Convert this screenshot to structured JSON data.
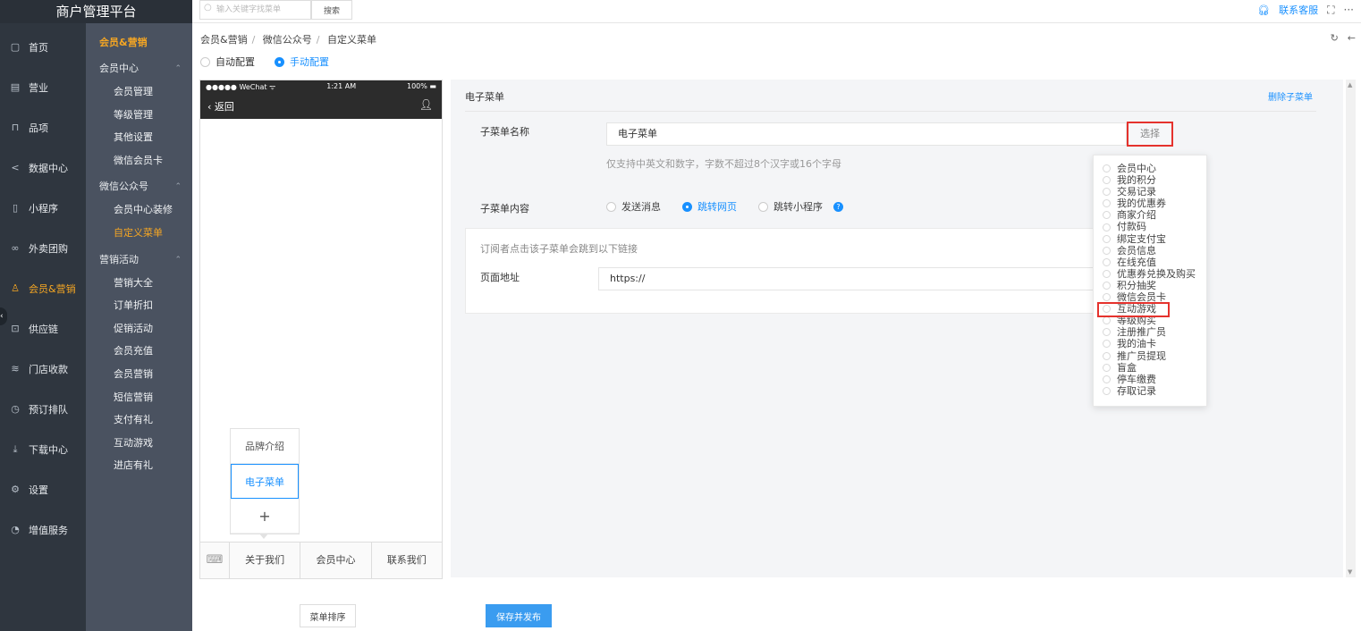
{
  "brand": "商户管理平台",
  "search": {
    "placeholder": "输入关键字找菜单",
    "button": "搜索"
  },
  "top_right": {
    "service": "联系客服",
    "fullscreen_icon": "⛶",
    "more_icon": "···"
  },
  "nav": [
    {
      "label": "首页",
      "icon": "▢"
    },
    {
      "label": "营业",
      "icon": "▤"
    },
    {
      "label": "品项",
      "icon": "⊓"
    },
    {
      "label": "数据中心",
      "icon": "<"
    },
    {
      "label": "小程序",
      "icon": "▯"
    },
    {
      "label": "外卖团购",
      "icon": "∞"
    },
    {
      "label": "会员&营销",
      "icon": "♙",
      "active": true
    },
    {
      "label": "供应链",
      "icon": "⊡"
    },
    {
      "label": "门店收款",
      "icon": "≋"
    },
    {
      "label": "预订排队",
      "icon": "◷"
    },
    {
      "label": "下载中心",
      "icon": "⤓"
    },
    {
      "label": "设置",
      "icon": "⚙"
    },
    {
      "label": "增值服务",
      "icon": "◔"
    }
  ],
  "subnav": {
    "title": "会员&营销",
    "groups": [
      {
        "name": "会员中心",
        "items": [
          "会员管理",
          "等级管理",
          "其他设置",
          "微信会员卡"
        ]
      },
      {
        "name": "微信公众号",
        "items": [
          "会员中心装修",
          "自定义菜单"
        ]
      },
      {
        "name": "营销活动",
        "items": [
          "营销大全",
          "订单折扣",
          "促销活动",
          "会员充值",
          "会员营销",
          "短信营销",
          "支付有礼",
          "互动游戏",
          "进店有礼"
        ]
      }
    ]
  },
  "breadcrumb": [
    "会员&营销",
    "微信公众号",
    "自定义菜单"
  ],
  "config": {
    "auto": "自动配置",
    "manual": "手动配置"
  },
  "phone": {
    "carrier": "●●●●● WeChat ᯤ",
    "time": "1:21 AM",
    "battery": "100% ▬",
    "back": "返回",
    "popup": [
      "品牌介绍",
      "电子菜单",
      "+"
    ],
    "footer": [
      "关于我们",
      "会员中心",
      "联系我们"
    ]
  },
  "editor": {
    "title": "电子菜单",
    "delete": "删除子菜单",
    "name_label": "子菜单名称",
    "name_value": "电子菜单",
    "choose": "选择",
    "hint": "仅支持中英文和数字，字数不超过8个汉字或16个字母",
    "content_label": "子菜单内容",
    "content_options": [
      "发送消息",
      "跳转网页",
      "跳转小程序"
    ],
    "link_hint": "订阅者点击该子菜单会跳到以下链接",
    "url_label": "页面地址",
    "url_value": "https://"
  },
  "dropdown": [
    "会员中心",
    "我的积分",
    "交易记录",
    "我的优惠券",
    "商家介绍",
    "付款码",
    "绑定支付宝",
    "会员信息",
    "在线充值",
    "优惠券兑换及购买",
    "积分抽奖",
    "微信会员卡",
    "互动游戏",
    "等级购买",
    "注册推广员",
    "我的油卡",
    "推广员提现",
    "盲盒",
    "停车缴费",
    "存取记录"
  ],
  "buttons": {
    "sort": "菜单排序",
    "save": "保存并发布"
  }
}
